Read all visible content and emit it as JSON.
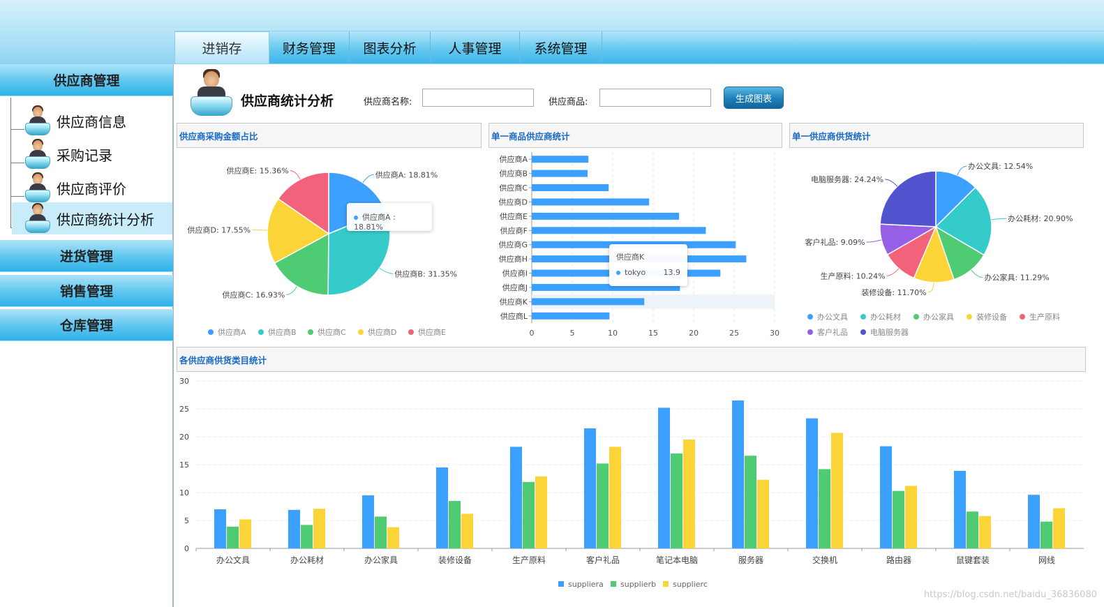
{
  "nav": {
    "tabs": [
      "进销存",
      "财务管理",
      "图表分析",
      "人事管理",
      "系统管理"
    ],
    "active": 0
  },
  "sidebar": {
    "groups": [
      "供应商管理",
      "进货管理",
      "销售管理",
      "仓库管理"
    ],
    "sub_items": [
      "供应商信息",
      "采购记录",
      "供应商评价",
      "供应商统计分析"
    ],
    "active_sub": 3
  },
  "page": {
    "title": "供应商统计分析",
    "supplier_name_label": "供应商名称:",
    "supplier_name_value": "",
    "product_label": "供应商品:",
    "product_value": "",
    "generate_button": "生成图表"
  },
  "panels": {
    "pie1_title": "供应商采购金额占比",
    "bar_title": "单一商品供应商统计",
    "pie2_title": "单一供应商供货统计",
    "grouped_title": "各供应商供货类目统计"
  },
  "tooltips": {
    "pie1": {
      "text": "供应商A : 18.81%"
    },
    "bar": {
      "title": "供应商K",
      "series": "tokyo",
      "value": "13.9"
    }
  },
  "colors": {
    "blue": "#3BA0FF",
    "cyan": "#36CBCB",
    "green": "#4ECB73",
    "yellow": "#FBD437",
    "red": "#F2637B",
    "purple": "#975FE5",
    "indigo": "#5254CF"
  },
  "watermark": "https://blog.csdn.net/baidu_36836080",
  "chart_data": [
    {
      "type": "pie",
      "title": "供应商采购金额占比",
      "labels": [
        "供应商A",
        "供应商B",
        "供应商C",
        "供应商D",
        "供应商E"
      ],
      "values": [
        18.81,
        31.35,
        16.93,
        17.55,
        15.36
      ],
      "slice_labels": [
        "供应商A: 18.81%",
        "供应商B: 31.35%",
        "供应商C: 16.93%",
        "供应商D: 17.55%",
        "供应商E: 15.36%"
      ],
      "colors": [
        "#3BA0FF",
        "#36CBCB",
        "#4ECB73",
        "#FBD437",
        "#F2637B"
      ],
      "legend": "bottom"
    },
    {
      "type": "bar",
      "orientation": "horizontal",
      "title": "单一商品供应商统计",
      "categories": [
        "供应商A",
        "供应商B",
        "供应商C",
        "供应商D",
        "供应商E",
        "供应商F",
        "供应商G",
        "供应商H",
        "供应商I",
        "供应商J",
        "供应商K",
        "供应商L"
      ],
      "values": [
        7,
        6.9,
        9.5,
        14.5,
        18.2,
        21.5,
        25.2,
        26.5,
        23.3,
        18.3,
        13.9,
        9.6
      ],
      "xlim": [
        0,
        30
      ],
      "xticks": [
        0,
        5,
        10,
        15,
        20,
        25,
        30
      ],
      "grid": true,
      "highlighted": 10
    },
    {
      "type": "pie",
      "title": "单一供应商供货统计",
      "labels": [
        "办公文具",
        "办公耗材",
        "办公家具",
        "装修设备",
        "生产原料",
        "客户礼品",
        "电脑服务器"
      ],
      "values": [
        12.54,
        20.9,
        11.29,
        11.7,
        10.24,
        9.09,
        24.24
      ],
      "slice_labels": [
        "办公文具: 12.54%",
        "办公耗材: 20.90%",
        "办公家具: 11.29%",
        "装修设备: 11.70%",
        "生产原料: 10.24%",
        "客户礼品: 9.09%",
        "电脑服务器: 24.24%"
      ],
      "colors": [
        "#3BA0FF",
        "#36CBCB",
        "#4ECB73",
        "#FBD437",
        "#F2637B",
        "#975FE5",
        "#5254CF"
      ],
      "legend": "bottom"
    },
    {
      "type": "bar",
      "title": "各供应商供货类目统计",
      "categories": [
        "办公文具",
        "办公耗材",
        "办公家具",
        "装修设备",
        "生产原料",
        "客户礼品",
        "笔记本电脑",
        "服务器",
        "交换机",
        "路由器",
        "鼠键套装",
        "网线"
      ],
      "series": [
        {
          "name": "suppliera",
          "values": [
            7,
            6.9,
            9.5,
            14.5,
            18.2,
            21.5,
            25.2,
            26.5,
            23.3,
            18.3,
            13.9,
            9.6
          ],
          "color": "#3BA0FF"
        },
        {
          "name": "supplierb",
          "values": [
            3.9,
            4.2,
            5.7,
            8.5,
            11.9,
            15.2,
            17,
            16.6,
            14.2,
            10.3,
            6.6,
            4.8
          ],
          "color": "#4ECB73"
        },
        {
          "name": "supplierc",
          "values": [
            5.2,
            7.1,
            3.8,
            6.2,
            12.9,
            18.2,
            19.5,
            12.3,
            20.7,
            11.2,
            5.8,
            7.2
          ],
          "color": "#FBD437"
        }
      ],
      "ylim": [
        0,
        30
      ],
      "yticks": [
        0,
        5,
        10,
        15,
        20,
        25,
        30
      ],
      "grid": true,
      "legend": "bottom"
    }
  ]
}
